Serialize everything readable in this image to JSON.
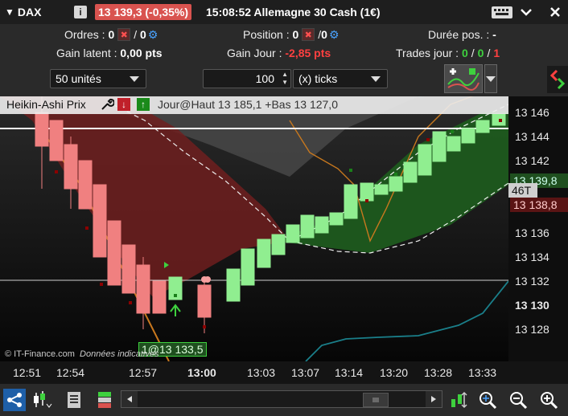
{
  "titlebar": {
    "instrument": "DAX",
    "price_change": "13 139,3 (-0,35%)",
    "time_name": "15:08:52 Allemagne 30 Cash (1€)",
    "info_icon": "info-icon",
    "colors": {
      "price_box": "#d9534f"
    }
  },
  "info": {
    "orders_label": "Ordres :",
    "orders_count_a": "0",
    "orders_sep": "/",
    "orders_count_b": "0",
    "position_label": "Position :",
    "position_count_a": "0",
    "position_count_b": "0",
    "duration_label": "Durée pos. :",
    "duration_value": "-",
    "latent_label": "Gain latent :",
    "latent_value": "0,00 pts",
    "day_gain_label": "Gain Jour :",
    "day_gain_value": "-2,85 pts",
    "trades_label": "Trades jour :",
    "trades_a": "0",
    "trades_b": "0",
    "trades_c": "1"
  },
  "orderbar": {
    "units": "50 unités",
    "ticks_value": "100",
    "ticks_unit": "(x) ticks"
  },
  "chart": {
    "indicator": "Heikin-Ashi Prix",
    "overlay_info": "Jour@Haut 13 185,1 +Bas 13 127,0",
    "order_marker": "1@13 133,5",
    "watermark": "© IT-Finance.com",
    "watermark_note": "Données indicatives"
  },
  "price_axis": {
    "labels": [
      "13 146",
      "13 144",
      "13 142",
      "13 140",
      "13 138",
      "13 136",
      "13 134",
      "13 132",
      "13 130",
      "13 128"
    ],
    "bold_label": "13 130",
    "tag_46t": "46T",
    "tag_green": "13 139,8",
    "tag_red": "13 138,8",
    "colors": {
      "green_tag": "#1f7a1f",
      "red_tag": "#8b1a1a"
    }
  },
  "time_axis": {
    "labels": [
      "12:51",
      "12:54",
      "12:57",
      "13:00",
      "13:03",
      "13:07",
      "13:14",
      "13:20",
      "13:28",
      "13:33"
    ],
    "bold_label": "13:00"
  }
}
